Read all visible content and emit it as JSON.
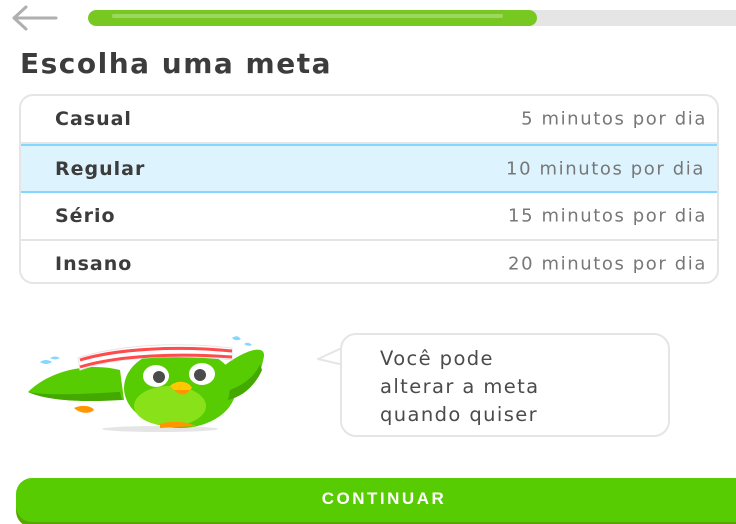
{
  "header": {
    "back_icon": "arrow-left-icon",
    "progress_fraction": 0.68,
    "colors": {
      "progress_fill": "#77c922",
      "progress_track": "#e5e5e5"
    }
  },
  "title": "Escolha uma meta",
  "goals": [
    {
      "name": "Casual",
      "time": "5 minutos por dia",
      "selected": false
    },
    {
      "name": "Regular",
      "time": "10 minutos por dia",
      "selected": true
    },
    {
      "name": "Sério",
      "time": "15 minutos por dia",
      "selected": false
    },
    {
      "name": "Insano",
      "time": "20 minutos por dia",
      "selected": false
    }
  ],
  "mascot": {
    "icon": "owl-mascot-icon"
  },
  "bubble": {
    "text": "Você pode\nalterar a meta\nquando quiser"
  },
  "continue_button": {
    "label": "CONTINUAR",
    "color": "#58cc02"
  },
  "colors": {
    "selected_bg": "#ddf4ff",
    "selected_border": "#84d8ff",
    "text_dark": "#3c3c3c",
    "text_muted": "#777777"
  }
}
